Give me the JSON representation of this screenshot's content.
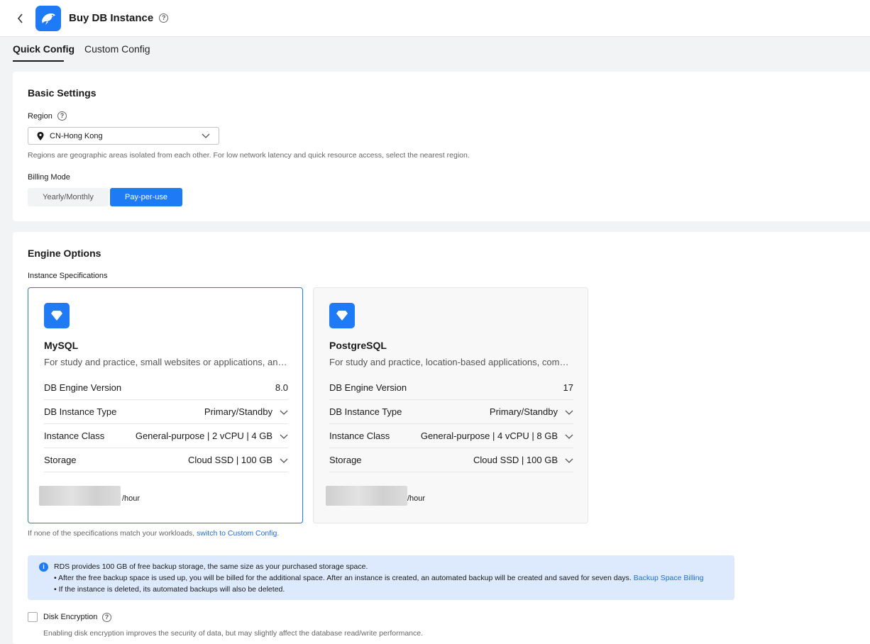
{
  "header": {
    "title": "Buy DB Instance"
  },
  "tabs": [
    {
      "label": "Quick Config",
      "active": true
    },
    {
      "label": "Custom Config",
      "active": false
    }
  ],
  "basic": {
    "heading": "Basic Settings",
    "region_label": "Region",
    "region_value": "CN-Hong Kong",
    "region_hint": "Regions are geographic areas isolated from each other. For low network latency and quick resource access, select the nearest region.",
    "billing_label": "Billing Mode",
    "billing_options": [
      "Yearly/Monthly",
      "Pay-per-use"
    ],
    "billing_selected": "Pay-per-use"
  },
  "engine": {
    "heading": "Engine Options",
    "spec_label": "Instance Specifications",
    "cards": [
      {
        "name": "MySQL",
        "desc": "For study and practice, small websites or applications, and lightweight workloads",
        "selected": true,
        "rows": [
          {
            "label": "DB Engine Version",
            "value": "8.0"
          },
          {
            "label": "DB Instance Type",
            "value": "Primary/Standby"
          },
          {
            "label": "Instance Class",
            "value": "General-purpose | 2 vCPU | 4 GB"
          },
          {
            "label": "Storage",
            "value": "Cloud SSD | 100 GB"
          }
        ],
        "price_unit": "/hour"
      },
      {
        "name": "PostgreSQL",
        "desc": "For study and practice, location-based applications, complex queries",
        "selected": false,
        "rows": [
          {
            "label": "DB Engine Version",
            "value": "17"
          },
          {
            "label": "DB Instance Type",
            "value": "Primary/Standby"
          },
          {
            "label": "Instance Class",
            "value": "General-purpose | 4 vCPU | 8 GB"
          },
          {
            "label": "Storage",
            "value": "Cloud SSD | 100 GB"
          }
        ],
        "price_unit": "/hour"
      }
    ],
    "note_text": "If none of the specifications match your workloads, ",
    "note_link": "switch to Custom Config",
    "note_end": ".",
    "info_line1": "RDS provides 100 GB of free backup storage, the same size as your purchased storage space.",
    "info_line2": "After the free backup space is used up, you will be billed for the additional space. After an instance is created, an automated backup will be created and saved for seven days.",
    "info_link": "Backup Space Billing",
    "info_line3": "If the instance is deleted, its automated backups will also be deleted.",
    "disk_label": "Disk Encryption",
    "disk_checked": false,
    "disk_hint": "Enabling disk encryption improves the security of data, but may slightly affect the database read/write performance."
  },
  "colors": {
    "accent": "#1e7bf5",
    "info_bg": "#ddeafd",
    "link": "#1e6ed8"
  }
}
